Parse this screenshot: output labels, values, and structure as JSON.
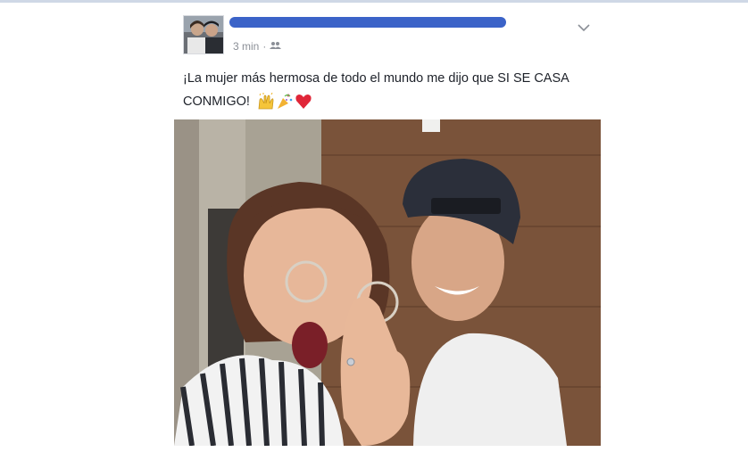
{
  "post": {
    "timestamp": "3 min",
    "separator": "·",
    "privacy_icon": "friends-icon",
    "text": "¡La mujer más hermosa de todo el mundo me dijo que SI SE CASA CONMIGO!",
    "emojis": [
      "raised-hands-icon",
      "party-popper-icon",
      "red-heart-icon"
    ],
    "menu_icon": "chevron-down-icon"
  },
  "colors": {
    "accent": "#3b63c8",
    "text": "#1d2129",
    "meta": "#8b8f97"
  }
}
